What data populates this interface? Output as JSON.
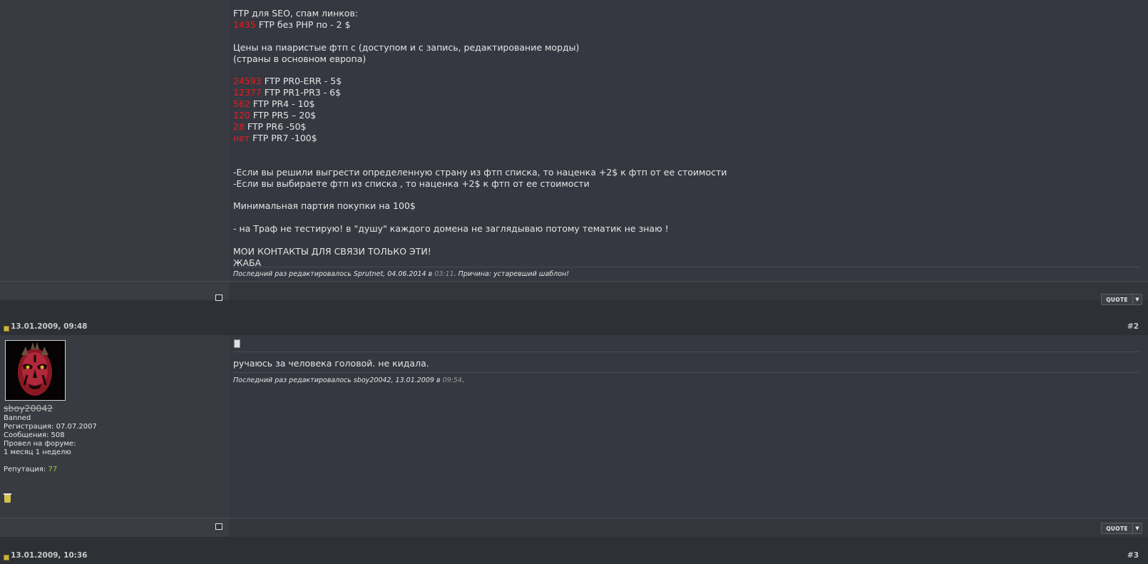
{
  "post1": {
    "lines": [
      [
        {
          "t": "FTP для SEO, спам линков:"
        }
      ],
      [
        {
          "t": "1435",
          "c": "red"
        },
        {
          "t": " FTP без PHP по - 2 $"
        }
      ],
      [
        {
          "t": ""
        }
      ],
      [
        {
          "t": "Цены на пиаристые фтп с (доступом и с запись, редактирование морды)"
        }
      ],
      [
        {
          "t": "(страны в основном европа)"
        }
      ],
      [
        {
          "t": ""
        }
      ],
      [
        {
          "t": "24593",
          "c": "red"
        },
        {
          "t": " FTP PR0-ERR - 5$"
        }
      ],
      [
        {
          "t": "12377",
          "c": "red"
        },
        {
          "t": " FTP PR1-PR3 - 6$"
        }
      ],
      [
        {
          "t": "562",
          "c": "red"
        },
        {
          "t": " FTP PR4 - 10$"
        }
      ],
      [
        {
          "t": "120",
          "c": "red"
        },
        {
          "t": " FTP PR5 – 20$"
        }
      ],
      [
        {
          "t": "28",
          "c": "red"
        },
        {
          "t": " FTP PR6 -50$"
        }
      ],
      [
        {
          "t": "нет",
          "c": "red"
        },
        {
          "t": " FTP PR7 -100$"
        }
      ],
      [
        {
          "t": ""
        }
      ],
      [
        {
          "t": ""
        }
      ],
      [
        {
          "t": "-Если вы решили выгрести определенную страну из фтп списка, то наценка +2$ к фтп от ее стоимости"
        }
      ],
      [
        {
          "t": "-Если вы выбираете фтп из списка , то наценка +2$ к фтп от ее стоимости"
        }
      ],
      [
        {
          "t": ""
        }
      ],
      [
        {
          "t": "Минимальная партия покупки на 100$"
        }
      ],
      [
        {
          "t": ""
        }
      ],
      [
        {
          "t": "- на Траф не тестирую! в \"душу\" каждого домена не заглядываю потому тематик не знаю !"
        }
      ],
      [
        {
          "t": ""
        }
      ],
      [
        {
          "t": "МОИ КОНТАКТЫ ДЛЯ СВЯЗИ ТОЛЬКО ЭТИ!"
        }
      ],
      [
        {
          "t": "ЖАБА"
        }
      ]
    ],
    "edit_prefix": "Последний раз редактировалось Sprutnet, 04.06.2014 в ",
    "edit_time": "03:11",
    "edit_suffix": ". Причина: устаревший шаблон!"
  },
  "post2": {
    "date": "13.01.2009, 09:48",
    "number": "#2",
    "username": "sboy20042",
    "user_info": "Banned\nРегистрация: 07.07.2007\nСообщения: 508\nПровел на форуме:\n1 месяц 1 неделю",
    "rep_label": "Репутация: ",
    "rep_value": "77",
    "message": "ручаюсь за человека головой. не кидала.",
    "edit_prefix": "Последний раз редактировалось sboy20042, 13.01.2009 в ",
    "edit_time": "09:54",
    "edit_suffix": "."
  },
  "post3": {
    "date": "13.01.2009, 10:36",
    "number": "#3"
  },
  "quote_label": "QUOTE",
  "quote_arrow": "▼",
  "icons": {
    "multiquote": "multiquote-checkbox-icon",
    "post_status": "post-status-icon",
    "message_icon": "message-icon",
    "trash": "trash-icon"
  }
}
